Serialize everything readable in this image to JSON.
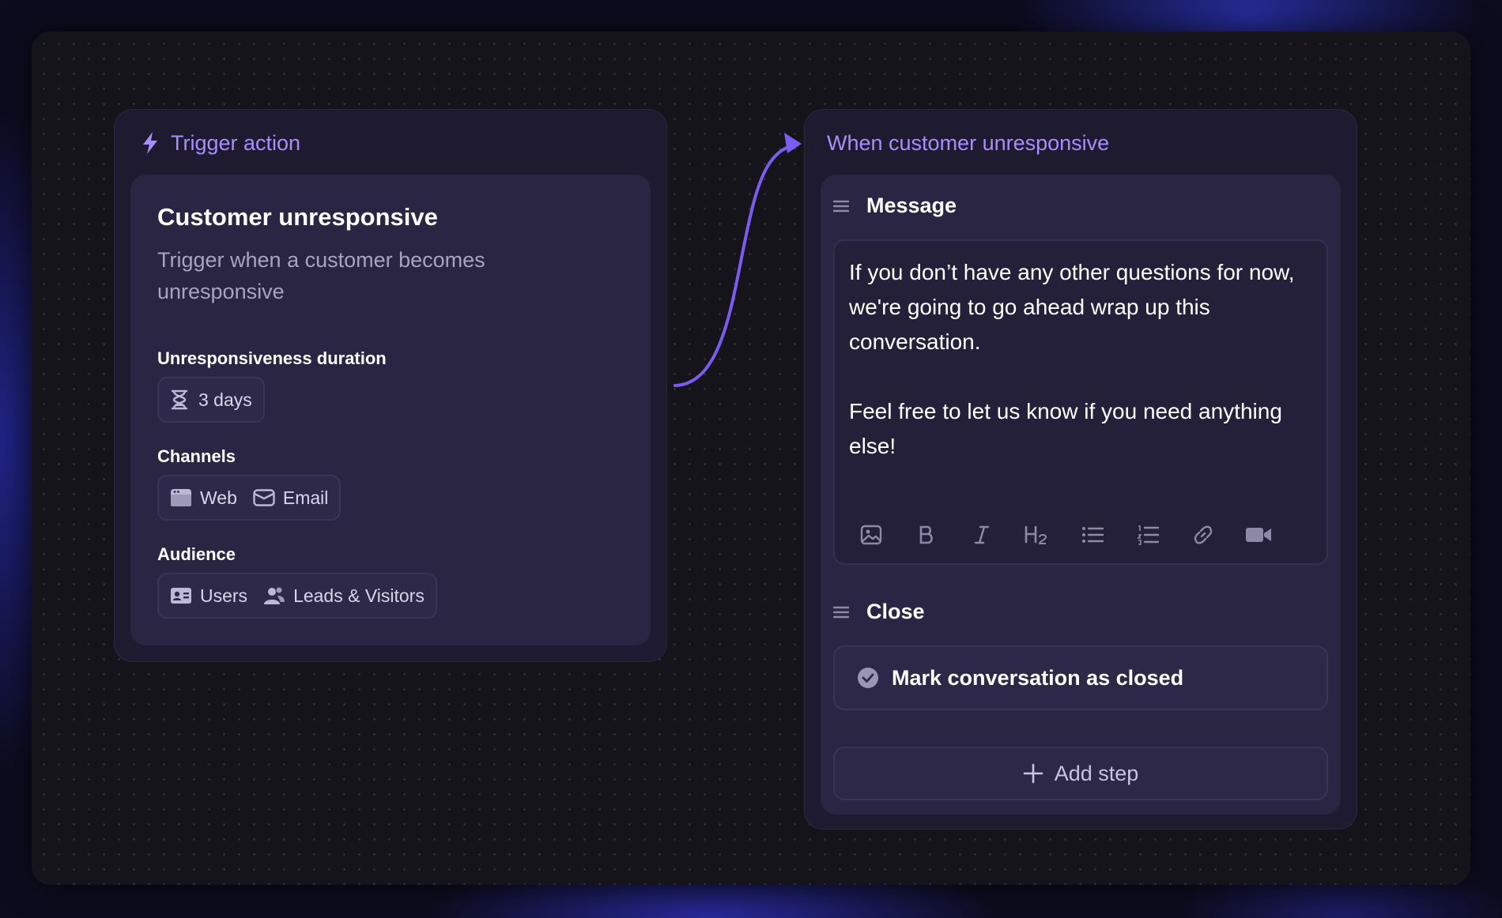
{
  "trigger": {
    "header": "Trigger action",
    "title": "Customer unresponsive",
    "subtitle": "Trigger when a customer becomes unresponsive",
    "duration_label": "Unresponsiveness duration",
    "duration_value": "3 days",
    "channels_label": "Channels",
    "channels": [
      "Web",
      "Email"
    ],
    "audience_label": "Audience",
    "audience": [
      "Users",
      "Leads & Visitors"
    ]
  },
  "workflow": {
    "header": "When customer unresponsive",
    "message_title": "Message",
    "message_body": "If you don’t have any other questions for now, we're going to go ahead wrap up this conversation.\n\nFeel free to let us know if you need anything else!",
    "toolbar": [
      "image-icon",
      "bold-icon",
      "italic-icon",
      "heading-icon",
      "bullet-list-icon",
      "numbered-list-icon",
      "link-icon",
      "video-icon"
    ],
    "close_title": "Close",
    "close_action": "Mark conversation as closed",
    "add_step": "Add step"
  },
  "colors": {
    "accent": "#a98dfb",
    "connector": "#7c5cf0"
  }
}
